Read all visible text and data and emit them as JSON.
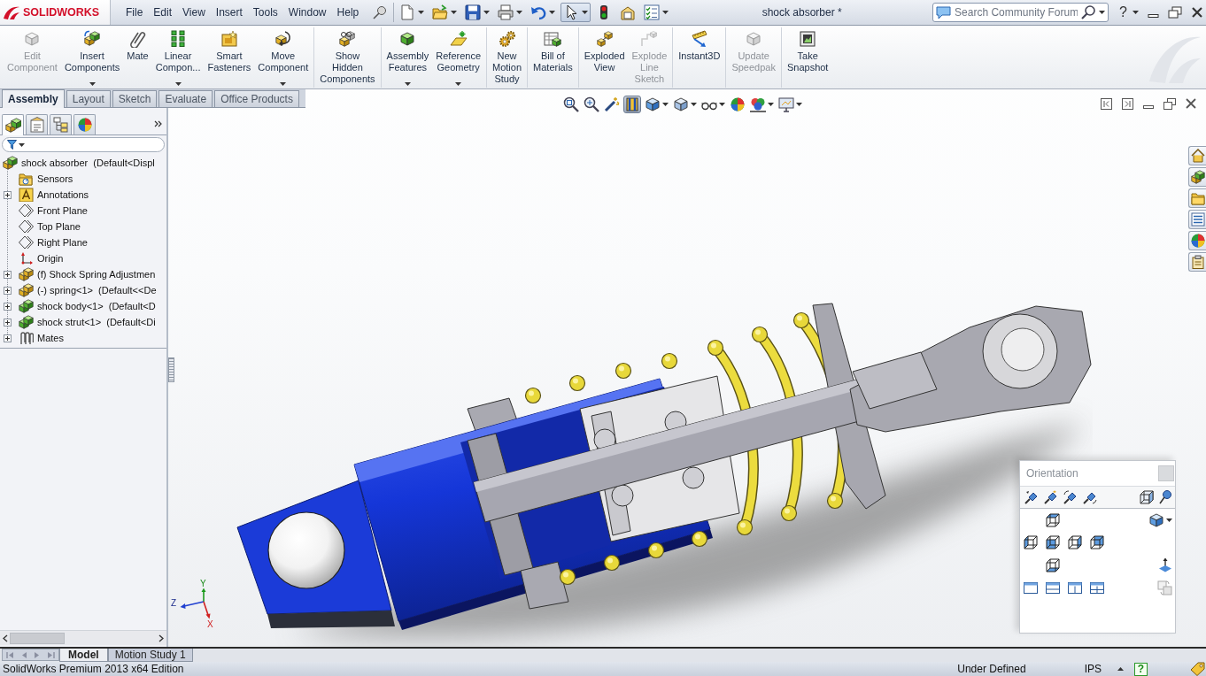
{
  "app_bar": {
    "logo": "SOLIDWORKS",
    "menu": [
      "File",
      "Edit",
      "View",
      "Insert",
      "Tools",
      "Window",
      "Help"
    ],
    "quick_access": [
      {
        "dropdown": true,
        "on": false
      },
      {
        "dropdown": true,
        "on": false
      },
      {
        "dropdown": true,
        "on": false
      },
      {
        "dropdown": true,
        "on": false
      },
      {
        "dropdown": true,
        "on": false
      },
      {
        "dropdown": true,
        "on": true
      },
      {
        "dropdown": false,
        "on": false
      },
      {
        "dropdown": false,
        "on": false
      },
      {
        "dropdown": true,
        "on": false
      }
    ],
    "document_title": "shock absorber *",
    "search": {
      "placeholder": "Search Community Forum"
    },
    "help": "?"
  },
  "command_manager": {
    "groups": [
      [
        {
          "label": "Edit Component",
          "disabled": true,
          "dropdown": false
        },
        {
          "label": "Insert Components",
          "disabled": false,
          "dropdown": true
        },
        {
          "label": "Mate",
          "disabled": false,
          "dropdown": false
        },
        {
          "label": "Linear Compon...",
          "disabled": false,
          "dropdown": true
        },
        {
          "label": "Smart Fasteners",
          "disabled": false,
          "dropdown": false
        },
        {
          "label": "Move Component",
          "disabled": false,
          "dropdown": true
        }
      ],
      [
        {
          "label": "Show Hidden Components",
          "disabled": false,
          "dropdown": false
        }
      ],
      [
        {
          "label": "Assembly Features",
          "disabled": false,
          "dropdown": true
        },
        {
          "label": "Reference Geometry",
          "disabled": false,
          "dropdown": true
        }
      ],
      [
        {
          "label": "New Motion Study",
          "disabled": false,
          "dropdown": false
        }
      ],
      [
        {
          "label": "Bill of Materials",
          "disabled": false,
          "dropdown": false
        }
      ],
      [
        {
          "label": "Exploded View",
          "disabled": false,
          "dropdown": false
        },
        {
          "label": "Explode Line Sketch",
          "disabled": true,
          "dropdown": false
        }
      ],
      [
        {
          "label": "Instant3D",
          "disabled": false,
          "dropdown": false
        }
      ],
      [
        {
          "label": "Update Speedpak",
          "disabled": true,
          "dropdown": false
        }
      ],
      [
        {
          "label": "Take Snapshot",
          "disabled": false,
          "dropdown": false
        }
      ]
    ]
  },
  "tabs": [
    {
      "label": "Assembly",
      "selected": true
    },
    {
      "label": "Layout",
      "selected": false
    },
    {
      "label": "Sketch",
      "selected": false
    },
    {
      "label": "Evaluate",
      "selected": false
    },
    {
      "label": "Office Products",
      "selected": false
    }
  ],
  "view_toolbar": [
    {
      "on": false,
      "dropdown": false
    },
    {
      "on": false,
      "dropdown": false
    },
    {
      "on": false,
      "dropdown": false
    },
    {
      "on": true,
      "dropdown": false
    },
    {
      "on": false,
      "dropdown": true
    },
    {
      "on": false,
      "dropdown": true
    },
    {
      "on": false,
      "dropdown": true
    },
    {
      "on": false,
      "dropdown": false
    },
    {
      "on": false,
      "dropdown": true
    },
    {
      "on": false,
      "dropdown": true
    }
  ],
  "feature_manager": {
    "panel_tabs": [
      {
        "selected": true
      },
      {
        "selected": false
      },
      {
        "selected": false
      },
      {
        "selected": false
      }
    ],
    "tree": {
      "label": "shock absorber  (Default<Displ",
      "kind": "assembly",
      "children": [
        {
          "label": "Sensors",
          "kind": "sensors"
        },
        {
          "label": "Annotations",
          "kind": "annotations",
          "expanded": false
        },
        {
          "label": "Front Plane",
          "kind": "plane"
        },
        {
          "label": "Top Plane",
          "kind": "plane"
        },
        {
          "label": "Right Plane",
          "kind": "plane"
        },
        {
          "label": "Origin",
          "kind": "origin"
        },
        {
          "label": "(f) Shock Spring Adjustmen",
          "kind": "subassembly",
          "expanded": false
        },
        {
          "label": "(-) spring<1>  (Default<<De",
          "kind": "subassembly",
          "expanded": false
        },
        {
          "label": "shock body<1>  (Default<D",
          "kind": "part",
          "expanded": false
        },
        {
          "label": "shock strut<1>  (Default<Di",
          "kind": "part",
          "expanded": false
        },
        {
          "label": "Mates",
          "kind": "mates",
          "expanded": false
        }
      ]
    }
  },
  "graphics": {
    "triad": [
      "Y",
      "Z",
      "X"
    ],
    "orientation": {
      "title": "Orientation"
    }
  },
  "bottom_tabs": [
    {
      "label": "Model",
      "selected": true
    },
    {
      "label": "Motion Study 1",
      "selected": false
    }
  ],
  "status_bar": {
    "edition": "SolidWorks Premium 2013 x64 Edition",
    "state": "Under Defined",
    "units": "IPS",
    "help": "?"
  }
}
